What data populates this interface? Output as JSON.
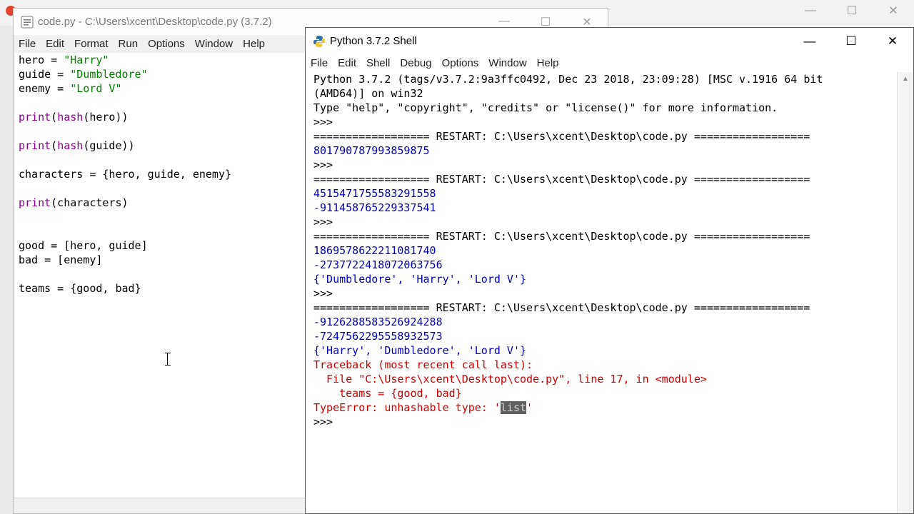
{
  "editor": {
    "title": "code.py - C:\\Users\\xcent\\Desktop\\code.py (3.7.2)",
    "menu": [
      "File",
      "Edit",
      "Format",
      "Run",
      "Options",
      "Window",
      "Help"
    ],
    "code": [
      [
        {
          "t": "hero = ",
          "c": "plain"
        },
        {
          "t": "\"Harry\"",
          "c": "str"
        }
      ],
      [
        {
          "t": "guide = ",
          "c": "plain"
        },
        {
          "t": "\"Dumbledore\"",
          "c": "str"
        }
      ],
      [
        {
          "t": "enemy = ",
          "c": "plain"
        },
        {
          "t": "\"Lord V\"",
          "c": "str"
        }
      ],
      [],
      [
        {
          "t": "print",
          "c": "kw"
        },
        {
          "t": "(",
          "c": "plain"
        },
        {
          "t": "hash",
          "c": "kw"
        },
        {
          "t": "(hero))",
          "c": "plain"
        }
      ],
      [],
      [
        {
          "t": "print",
          "c": "kw"
        },
        {
          "t": "(",
          "c": "plain"
        },
        {
          "t": "hash",
          "c": "kw"
        },
        {
          "t": "(guide))",
          "c": "plain"
        }
      ],
      [],
      [
        {
          "t": "characters = {hero, guide, enemy}",
          "c": "plain"
        }
      ],
      [],
      [
        {
          "t": "print",
          "c": "kw"
        },
        {
          "t": "(characters)",
          "c": "plain"
        }
      ],
      [],
      [],
      [
        {
          "t": "good = [hero, guide]",
          "c": "plain"
        }
      ],
      [
        {
          "t": "bad = [enemy]",
          "c": "plain"
        }
      ],
      [],
      [
        {
          "t": "teams = {good, bad}",
          "c": "plain"
        }
      ]
    ]
  },
  "shell": {
    "title": "Python 3.7.2 Shell",
    "menu": [
      "File",
      "Edit",
      "Shell",
      "Debug",
      "Options",
      "Window",
      "Help"
    ],
    "lines": [
      [
        {
          "t": "Python 3.7.2 (tags/v3.7.2:9a3ffc0492, Dec 23 2018, 23:09:28) [MSC v.1916 64 bit",
          "c": "plain"
        }
      ],
      [
        {
          "t": "(AMD64)] on win32",
          "c": "plain"
        }
      ],
      [
        {
          "t": "Type \"help\", \"copyright\", \"credits\" or \"license()\" for more information.",
          "c": "plain"
        }
      ],
      [
        {
          "t": ">>> ",
          "c": "plain"
        }
      ],
      [
        {
          "t": "================== RESTART: C:\\Users\\xcent\\Desktop\\code.py ==================",
          "c": "plain"
        }
      ],
      [
        {
          "t": "801790787993859875",
          "c": "out"
        }
      ],
      [
        {
          "t": ">>> ",
          "c": "plain"
        }
      ],
      [
        {
          "t": "================== RESTART: C:\\Users\\xcent\\Desktop\\code.py ==================",
          "c": "plain"
        }
      ],
      [
        {
          "t": "4515471755583291558",
          "c": "out"
        }
      ],
      [
        {
          "t": "-911458765229337541",
          "c": "out"
        }
      ],
      [
        {
          "t": ">>> ",
          "c": "plain"
        }
      ],
      [
        {
          "t": "================== RESTART: C:\\Users\\xcent\\Desktop\\code.py ==================",
          "c": "plain"
        }
      ],
      [
        {
          "t": "1869578622211081740",
          "c": "out"
        }
      ],
      [
        {
          "t": "-2737722418072063756",
          "c": "out"
        }
      ],
      [
        {
          "t": "{'Dumbledore', 'Harry', 'Lord V'}",
          "c": "out"
        }
      ],
      [
        {
          "t": ">>> ",
          "c": "plain"
        }
      ],
      [
        {
          "t": "================== RESTART: C:\\Users\\xcent\\Desktop\\code.py ==================",
          "c": "plain"
        }
      ],
      [
        {
          "t": "-9126288583526924288",
          "c": "out"
        }
      ],
      [
        {
          "t": "-7247562295558932573",
          "c": "out"
        }
      ],
      [
        {
          "t": "{'Harry', 'Dumbledore', 'Lord V'}",
          "c": "out"
        }
      ],
      [
        {
          "t": "Traceback (most recent call last):",
          "c": "err"
        }
      ],
      [
        {
          "t": "  File \"C:\\Users\\xcent\\Desktop\\code.py\", line 17, in <module>",
          "c": "err"
        }
      ],
      [
        {
          "t": "    teams = {good, bad}",
          "c": "err"
        }
      ],
      [
        {
          "t": "TypeError: unhashable type: '",
          "c": "err"
        },
        {
          "t": "list",
          "c": "err sel"
        },
        {
          "t": "'",
          "c": "err"
        }
      ],
      [
        {
          "t": ">>> ",
          "c": "plain"
        }
      ]
    ]
  },
  "colors": {
    "keyword": "#900090",
    "string": "#008000",
    "output": "#0000c0",
    "error": "#d00000"
  }
}
